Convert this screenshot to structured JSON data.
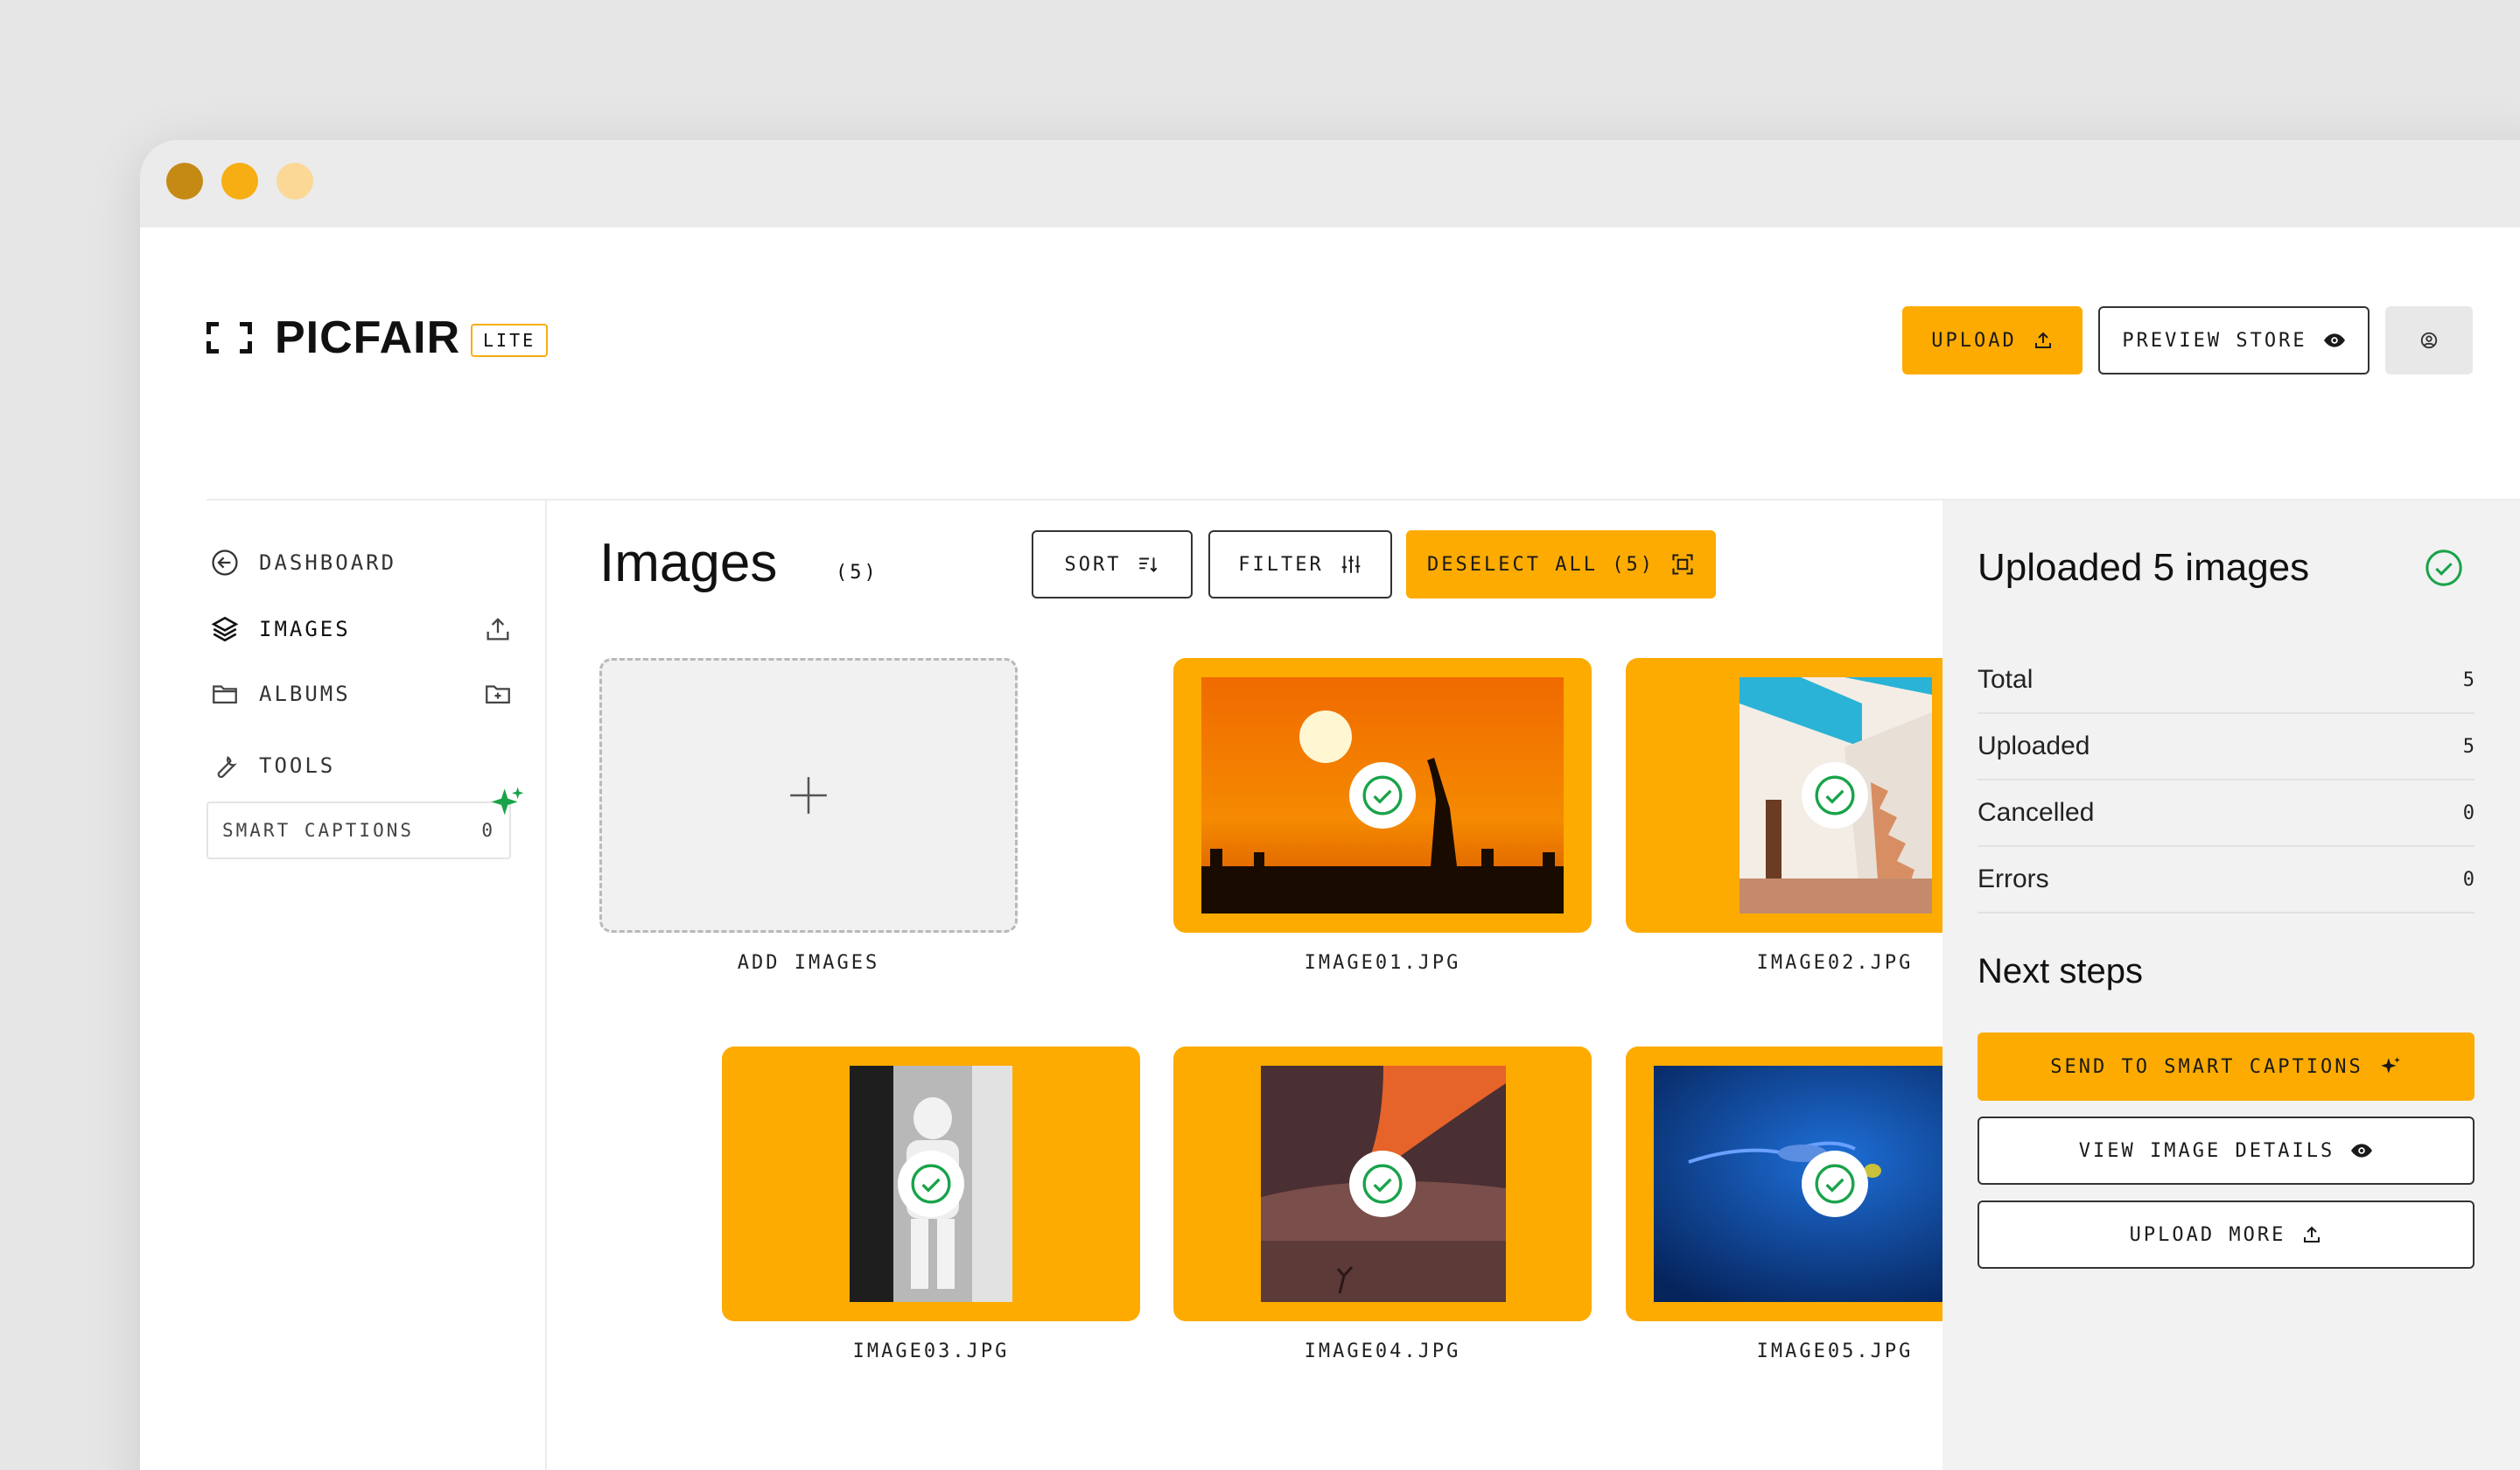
{
  "brand": {
    "name": "PICFAIR",
    "badge": "LITE"
  },
  "header": {
    "upload_label": "UPLOAD",
    "preview_label": "PREVIEW STORE"
  },
  "sidebar": {
    "items": [
      {
        "label": "DASHBOARD"
      },
      {
        "label": "IMAGES"
      },
      {
        "label": "ALBUMS"
      },
      {
        "label": "TOOLS"
      }
    ],
    "smart_captions": {
      "label": "SMART CAPTIONS",
      "count": "0"
    }
  },
  "main": {
    "title": "Images",
    "count": "(5)",
    "toolbar": {
      "sort_label": "SORT",
      "filter_label": "FILTER",
      "deselect_label": "DESELECT ALL (5)"
    },
    "add_label": "ADD IMAGES",
    "images": [
      {
        "name": "IMAGE01.JPG"
      },
      {
        "name": "IMAGE02.JPG"
      },
      {
        "name": "IMAGE03.JPG"
      },
      {
        "name": "IMAGE04.JPG"
      },
      {
        "name": "IMAGE05.JPG"
      }
    ]
  },
  "panel": {
    "title": "Uploaded 5 images",
    "stats": [
      {
        "label": "Total",
        "value": "5"
      },
      {
        "label": "Uploaded",
        "value": "5"
      },
      {
        "label": "Cancelled",
        "value": "0"
      },
      {
        "label": "Errors",
        "value": "0"
      }
    ],
    "next_title": "Next steps",
    "actions": {
      "send_label": "SEND TO SMART CAPTIONS",
      "details_label": "VIEW IMAGE DETAILS",
      "upload_more_label": "UPLOAD MORE"
    }
  },
  "colors": {
    "accent": "#fdab00",
    "success": "#19a34a",
    "background": "#e6e6e6"
  },
  "icons": [
    "arrow-left-circle-icon",
    "layers-icon",
    "folder-icon",
    "wrench-icon",
    "upload-icon",
    "folder-plus-icon",
    "sparkle-icon",
    "eye-icon",
    "account-icon",
    "sort-icon",
    "sliders-icon",
    "select-icon",
    "check-circle-icon",
    "plus-icon"
  ]
}
